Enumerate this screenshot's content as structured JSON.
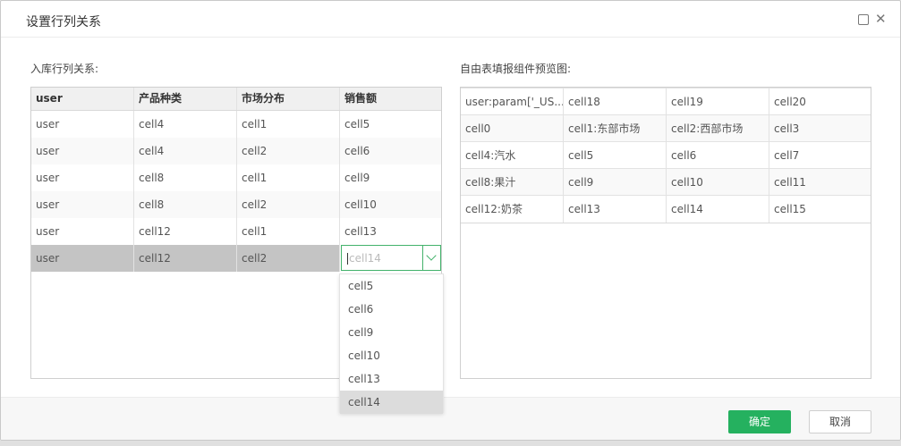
{
  "dialog": {
    "title": "设置行列关系",
    "maximize_icon": "maximize-icon",
    "close_icon": "close-icon",
    "close_glyph": "✕"
  },
  "left": {
    "label": "入库行列关系:",
    "headers": [
      "user",
      "产品种类",
      "市场分布",
      "销售额"
    ],
    "rows": [
      [
        "user",
        "cell4",
        "cell1",
        "cell5"
      ],
      [
        "user",
        "cell4",
        "cell2",
        "cell6"
      ],
      [
        "user",
        "cell8",
        "cell1",
        "cell9"
      ],
      [
        "user",
        "cell8",
        "cell2",
        "cell10"
      ],
      [
        "user",
        "cell12",
        "cell1",
        "cell13"
      ],
      [
        "user",
        "cell12",
        "cell2",
        "cell14"
      ]
    ],
    "selected_row": 5,
    "editor_value": "cell14",
    "dropdown_options": [
      "cell5",
      "cell6",
      "cell9",
      "cell10",
      "cell13",
      "cell14"
    ],
    "dropdown_active": "cell14"
  },
  "right": {
    "label": "自由表填报组件预览图:",
    "rows": [
      [
        "user:param['_US...",
        "cell18",
        "cell19",
        "cell20"
      ],
      [
        "cell0",
        "cell1:东部市场",
        "cell2:西部市场",
        "cell3"
      ],
      [
        "cell4:汽水",
        "cell5",
        "cell6",
        "cell7"
      ],
      [
        "cell8:果汁",
        "cell9",
        "cell10",
        "cell11"
      ],
      [
        "cell12:奶茶",
        "cell13",
        "cell14",
        "cell15"
      ]
    ]
  },
  "footer": {
    "ok_label": "确定",
    "cancel_label": "取消"
  },
  "colors": {
    "accent": "#25b15f",
    "selected_row": "#c4c4c4"
  }
}
